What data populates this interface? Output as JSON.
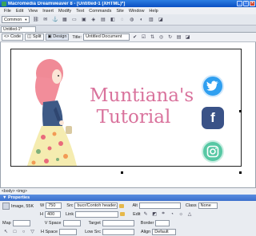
{
  "app": {
    "title": "Macromedia Dreamweaver 8 - [Untitled-1 (XHTML)*]"
  },
  "menubar": {
    "items": [
      "File",
      "Edit",
      "View",
      "Insert",
      "Modify",
      "Text",
      "Commands",
      "Site",
      "Window",
      "Help"
    ]
  },
  "insertbar": {
    "category": "Common"
  },
  "document": {
    "tab_label": "Untitled-1*",
    "view_code": "Code",
    "view_split": "Split",
    "view_design": "Design",
    "title_label": "Title:",
    "title_value": "Untitled Document",
    "content": {
      "heading_line1": "Muntiana's",
      "heading_line2": "Tutorial"
    }
  },
  "statusbar": {
    "tag": "<body> <img>"
  },
  "properties": {
    "header": "▼ Properties",
    "image_label": "Image, 55K",
    "w_label": "W",
    "w_value": "750",
    "h_label": "H",
    "h_value": "400",
    "src_label": "Src",
    "src_value": "bucr/Contoh header.jpg",
    "link_label": "Link",
    "alt_label": "Alt",
    "edit_label": "Edit",
    "class_label": "Class",
    "class_value": "None",
    "map_label": "Map",
    "vspace_label": "V Space",
    "hspace_label": "H Space",
    "target_label": "Target",
    "border_label": "Border",
    "lowsrc_label": "Low Src",
    "align_label": "Align",
    "align_value": "Default"
  },
  "colors": {
    "twitter": "#2f9ff0",
    "facebook": "#3a5287",
    "instagram": "#57c8a4",
    "title_pink": "#d9729c"
  }
}
